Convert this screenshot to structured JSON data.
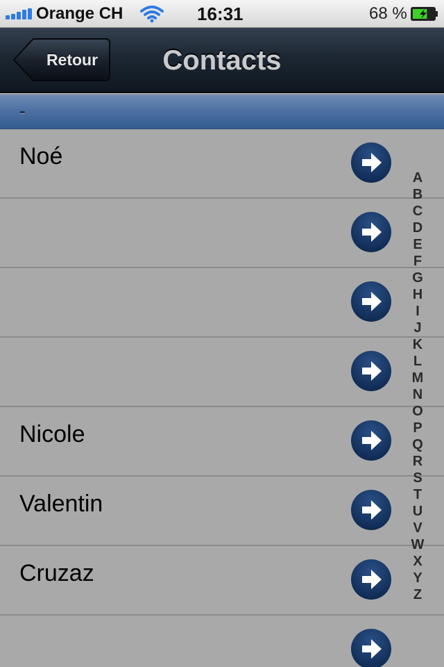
{
  "status_bar": {
    "carrier": "Orange CH",
    "time": "16:31",
    "battery_percent": "68 %",
    "battery_level": 0.68,
    "signal_icon": "signal-bars-icon",
    "wifi_icon": "wifi-icon",
    "battery_icon": "battery-charging-icon"
  },
  "nav": {
    "back_label": "Retour",
    "title": "Contacts"
  },
  "section": {
    "label": "-"
  },
  "rows": [
    {
      "label": "Noé"
    },
    {
      "label": ""
    },
    {
      "label": ""
    },
    {
      "label": ""
    },
    {
      "label": "Nicole"
    },
    {
      "label": "Valentin"
    },
    {
      "label": "Cruzaz"
    },
    {
      "label": ""
    }
  ],
  "index_letters": [
    "A",
    "B",
    "C",
    "D",
    "E",
    "F",
    "G",
    "H",
    "I",
    "J",
    "K",
    "L",
    "M",
    "N",
    "O",
    "P",
    "Q",
    "R",
    "S",
    "T",
    "U",
    "V",
    "W",
    "X",
    "Y",
    "Z"
  ],
  "colors": {
    "disclosure": "#0e2a52",
    "section_header": "#4a6fa0",
    "nav_bar": "#1d2733",
    "list_background": "#a9a9a9"
  }
}
